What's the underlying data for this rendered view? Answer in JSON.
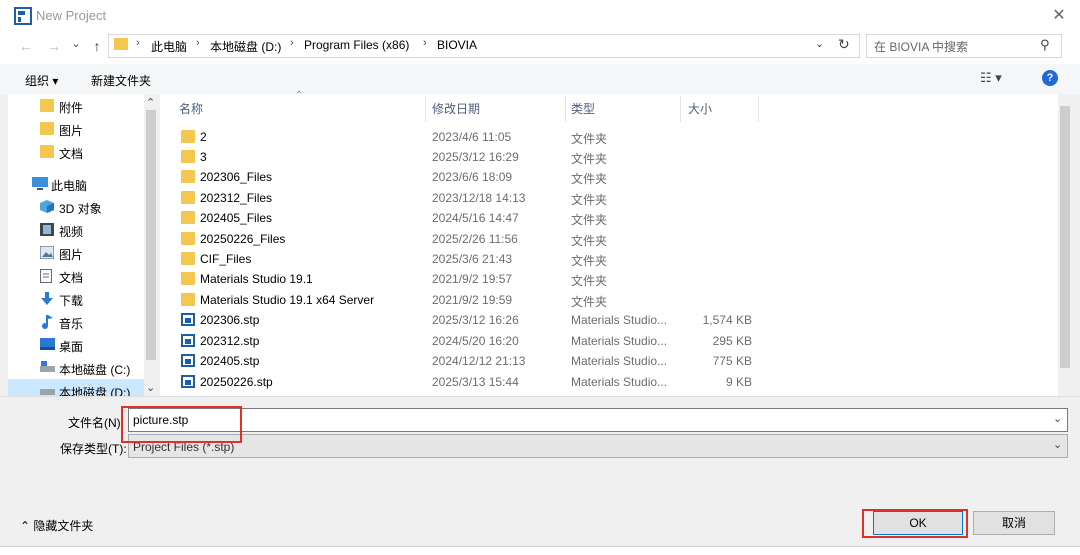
{
  "window": {
    "title": "New Project",
    "close_glyph": "✕"
  },
  "nav": {
    "back_glyph": "←",
    "forward_glyph": "→",
    "down_glyph": "⌄",
    "up_glyph": "↑",
    "breadcrumbs": [
      "此电脑",
      "本地磁盘 (D:)",
      "Program Files (x86)",
      "BIOVIA"
    ],
    "sep_glyph": "›",
    "dropdown_glyph": "⌄",
    "refresh_glyph": "↻",
    "search_placeholder": "在 BIOVIA 中搜索",
    "search_glyph": "⚲"
  },
  "toolbar": {
    "organize_label": "组织 ▾",
    "new_folder_label": "新建文件夹",
    "view_glyph": "☷ ▾",
    "help_glyph": "?"
  },
  "sidebar": {
    "items": [
      {
        "label": "附件",
        "icon": "folder-icon"
      },
      {
        "label": "图片",
        "icon": "folder-icon"
      },
      {
        "label": "文档",
        "icon": "folder-icon"
      },
      {
        "label": "此电脑",
        "icon": "computer-icon"
      },
      {
        "label": "3D 对象",
        "icon": "3d-objects-icon"
      },
      {
        "label": "视频",
        "icon": "video-icon"
      },
      {
        "label": "图片",
        "icon": "pictures-icon"
      },
      {
        "label": "文档",
        "icon": "documents-icon"
      },
      {
        "label": "下载",
        "icon": "download-icon"
      },
      {
        "label": "音乐",
        "icon": "music-icon"
      },
      {
        "label": "桌面",
        "icon": "desktop-icon"
      },
      {
        "label": "本地磁盘 (C:)",
        "icon": "drive-icon"
      },
      {
        "label": "本地磁盘 (D:)",
        "icon": "drive-icon"
      }
    ],
    "scroll_up_glyph": "⌃",
    "scroll_down_glyph": "⌄"
  },
  "columns": {
    "name": "名称",
    "modified": "修改日期",
    "type": "类型",
    "size": "大小",
    "sort_glyph": "⌃"
  },
  "files": [
    {
      "name": "2",
      "date": "2023/4/6 11:05",
      "type": "文件夹",
      "size": "",
      "kind": "folder"
    },
    {
      "name": "3",
      "date": "2025/3/12 16:29",
      "type": "文件夹",
      "size": "",
      "kind": "folder"
    },
    {
      "name": "202306_Files",
      "date": "2023/6/6 18:09",
      "type": "文件夹",
      "size": "",
      "kind": "folder"
    },
    {
      "name": "202312_Files",
      "date": "2023/12/18 14:13",
      "type": "文件夹",
      "size": "",
      "kind": "folder"
    },
    {
      "name": "202405_Files",
      "date": "2024/5/16 14:47",
      "type": "文件夹",
      "size": "",
      "kind": "folder"
    },
    {
      "name": "20250226_Files",
      "date": "2025/2/26 11:56",
      "type": "文件夹",
      "size": "",
      "kind": "folder"
    },
    {
      "name": "CIF_Files",
      "date": "2025/3/6 21:43",
      "type": "文件夹",
      "size": "",
      "kind": "folder"
    },
    {
      "name": "Materials Studio 19.1",
      "date": "2021/9/2 19:57",
      "type": "文件夹",
      "size": "",
      "kind": "folder"
    },
    {
      "name": "Materials Studio 19.1 x64 Server",
      "date": "2021/9/2 19:59",
      "type": "文件夹",
      "size": "",
      "kind": "folder"
    },
    {
      "name": "202306.stp",
      "date": "2025/3/12 16:26",
      "type": "Materials Studio...",
      "size": "1,574 KB",
      "kind": "stp"
    },
    {
      "name": "202312.stp",
      "date": "2024/5/20 16:20",
      "type": "Materials Studio...",
      "size": "295 KB",
      "kind": "stp"
    },
    {
      "name": "202405.stp",
      "date": "2024/12/12 21:13",
      "type": "Materials Studio...",
      "size": "775 KB",
      "kind": "stp"
    },
    {
      "name": "20250226.stp",
      "date": "2025/3/13 15:44",
      "type": "Materials Studio...",
      "size": "9 KB",
      "kind": "stp"
    }
  ],
  "form": {
    "filename_label": "文件名(N):",
    "filename_value": "picture.stp",
    "filetype_label": "保存类型(T):",
    "filetype_value": "Project Files (*.stp)",
    "dropdown_glyph": "⌄"
  },
  "footer": {
    "hide_folders_label": "⌃ 隐藏文件夹",
    "ok_label": "OK",
    "cancel_label": "取消"
  },
  "colors": {
    "highlight": "#e0302a",
    "folder": "#f4c750",
    "selection": "#cce8ff",
    "accent": "#0078d7"
  }
}
